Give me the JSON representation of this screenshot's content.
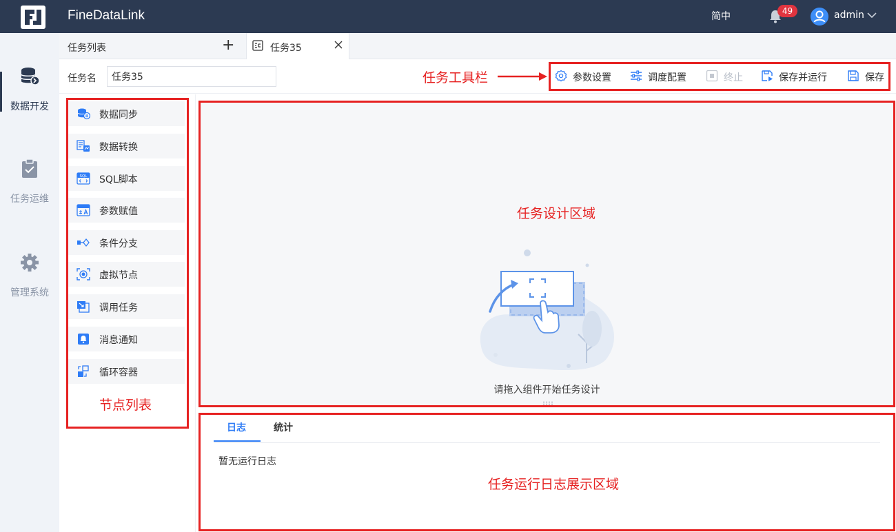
{
  "header": {
    "app_title": "FineDataLink",
    "language": "简中",
    "notification_count": "49",
    "user": "admin"
  },
  "nav": {
    "items": [
      {
        "label": "数据开发",
        "icon": "database-icon",
        "active": true
      },
      {
        "label": "任务运维",
        "icon": "clipboard-check-icon",
        "active": false
      },
      {
        "label": "管理系统",
        "icon": "gear-icon",
        "active": false
      }
    ]
  },
  "tabs": {
    "list_label": "任务列表",
    "add_symbol": "+",
    "task_tab_label": "任务35"
  },
  "task_name": {
    "label": "任务名",
    "value": "任务35"
  },
  "toolbar": {
    "params": "参数设置",
    "schedule": "调度配置",
    "stop": "终止",
    "save_run": "保存并运行",
    "save": "保存"
  },
  "nodes": [
    {
      "label": "数据同步",
      "icon": "data-sync-icon"
    },
    {
      "label": "数据转换",
      "icon": "data-transform-icon"
    },
    {
      "label": "SQL脚本",
      "icon": "sql-script-icon"
    },
    {
      "label": "参数赋值",
      "icon": "param-assign-icon"
    },
    {
      "label": "条件分支",
      "icon": "branch-icon"
    },
    {
      "label": "虚拟节点",
      "icon": "virtual-node-icon"
    },
    {
      "label": "调用任务",
      "icon": "call-task-icon"
    },
    {
      "label": "消息通知",
      "icon": "notification-icon"
    },
    {
      "label": "循环容器",
      "icon": "loop-container-icon"
    }
  ],
  "design": {
    "hint": "请拖入组件开始任务设计"
  },
  "log": {
    "tab_log": "日志",
    "tab_stats": "统计",
    "empty": "暂无运行日志"
  },
  "annotations": {
    "toolbar": "任务工具栏",
    "node_list": "节点列表",
    "design_area": "任务设计区域",
    "log_area": "任务运行日志展示区域"
  },
  "colors": {
    "header_bg": "#2c3a52",
    "accent": "#2e7cf6",
    "annotation": "#e62222",
    "badge": "#e0343f"
  }
}
